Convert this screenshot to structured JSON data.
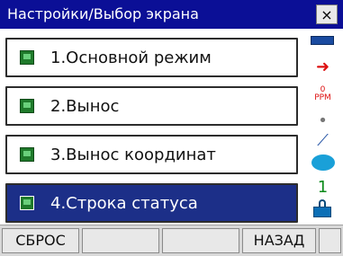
{
  "window": {
    "title": "Настройки/Выбор экрана",
    "close_label": "×"
  },
  "menu": {
    "items": [
      {
        "label": "1.Основной режим",
        "selected": false
      },
      {
        "label": "2.Вынос",
        "selected": false
      },
      {
        "label": "3.Вынос координат",
        "selected": false
      },
      {
        "label": "4.Строка статуса",
        "selected": true
      }
    ]
  },
  "status": {
    "ppm_value": "0",
    "ppm_unit": "PPM",
    "level_number": "1",
    "icons": [
      "battery-icon",
      "target-arrow-icon",
      "ppm-icon",
      "dot-icon",
      "prism-icon",
      "disk-icon",
      "level-icon",
      "lock-icon"
    ]
  },
  "softkeys": {
    "key1": "СБРОС",
    "key2": "",
    "key3": "",
    "key4": "НАЗАД",
    "key5": ""
  },
  "colors": {
    "titlebar": "#0b0f96",
    "selected_item": "#1c2f88",
    "softkey_bar": "#d8d8d8"
  }
}
